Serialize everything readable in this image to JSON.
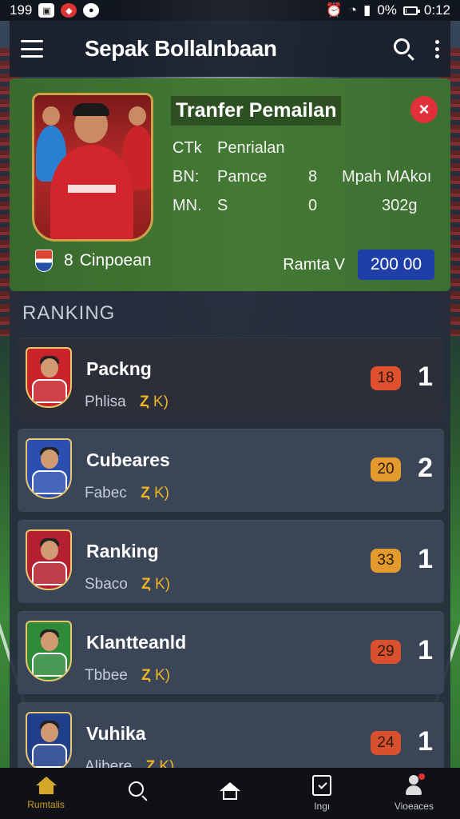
{
  "status_bar": {
    "time_left": "199",
    "battery": "0%",
    "clock": "0:12",
    "battery_level": 0.1
  },
  "app_bar": {
    "title": "Sepak Bollalnbaan"
  },
  "transfer": {
    "title": "Tranfer Pemailan",
    "close_label": "×",
    "row1": {
      "a": "CTk",
      "b": "Penrialan"
    },
    "row2": {
      "a": "BN:",
      "b": "Pamce",
      "c": "8",
      "d": "Mpah MAkoı"
    },
    "row3": {
      "a": "MN.",
      "b": "S",
      "c": "0",
      "d": "302g"
    },
    "club_name": "Cinpoean",
    "club_prefix": "8",
    "price_label": "Ramta V",
    "price_value": "200 00"
  },
  "ranking": {
    "heading": "RANKING",
    "items": [
      {
        "name": "Packng",
        "sub": "Phlisa",
        "coin": "Ȥ",
        "k": "K)",
        "pill": "18",
        "pill_color": "#e0502e",
        "num": "1",
        "shirt": "#c8242a",
        "style": "dark"
      },
      {
        "name": "Cubeares",
        "sub": "Fabec",
        "coin": "Ȥ",
        "k": "K)",
        "pill": "20",
        "pill_color": "#e39a2c",
        "num": "2",
        "shirt": "#2a4fb0",
        "style": "light"
      },
      {
        "name": "Ranking",
        "sub": "Sbaco",
        "coin": "Ȥ",
        "k": "K)",
        "pill": "33",
        "pill_color": "#e39a2c",
        "num": "1",
        "shirt": "#b52030",
        "style": "light"
      },
      {
        "name": "Klantteanld",
        "sub": "Tbbee",
        "coin": "Ȥ",
        "k": "K)",
        "pill": "29",
        "pill_color": "#d9502f",
        "num": "1",
        "shirt": "#2f8a3a",
        "style": "light"
      },
      {
        "name": "Vuhika",
        "sub": "Alibere",
        "coin": "Ȥ",
        "k": "K)",
        "pill": "24",
        "pill_color": "#d9502f",
        "num": "1",
        "shirt": "#1f3f8a",
        "style": "light"
      }
    ]
  },
  "bottom_nav": {
    "items": [
      {
        "label": "Rumtalis",
        "icon": "home-icon",
        "active": true
      },
      {
        "label": "",
        "icon": "search-icon"
      },
      {
        "label": "",
        "icon": "house-outline-icon"
      },
      {
        "label": "Ingı",
        "icon": "clipboard-check-icon"
      },
      {
        "label": "Vioeaces",
        "icon": "profile-icon"
      }
    ]
  }
}
